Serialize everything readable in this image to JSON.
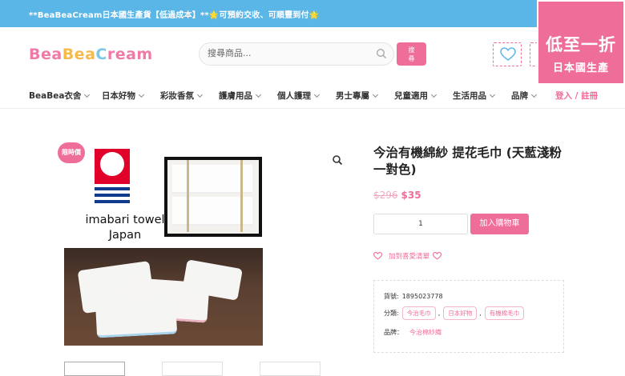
{
  "topbar": {
    "promo": "**BeaBeaCream日本國生產貨【低過成本】**🌟可預約交收、可順豐到付🌟",
    "social_icons": [
      "facebook-icon",
      "instagram-icon"
    ]
  },
  "header": {
    "logo_parts": [
      "Bea",
      "Bea",
      "C",
      "ream",
      ""
    ],
    "search_placeholder": "搜尋商品...",
    "search_button": "搜\n尋"
  },
  "badge": {
    "line1": "低至一折",
    "line2": "日本國生產"
  },
  "nav": {
    "items": [
      {
        "label": "BeaBea衣舍"
      },
      {
        "label": "日本好物"
      },
      {
        "label": "彩妝香氛"
      },
      {
        "label": "護膚用品"
      },
      {
        "label": "個人護理"
      },
      {
        "label": "男士專屬"
      },
      {
        "label": "兒童適用"
      },
      {
        "label": "生活用品"
      },
      {
        "label": "品牌"
      }
    ],
    "login": "登入 / 註冊"
  },
  "gallery": {
    "sale_tag": "限時價",
    "brand_line1": "imabari towel",
    "brand_line2": "Japan"
  },
  "product": {
    "title": "今治有機綿紗 提花毛巾 (天藍淺粉一對色)",
    "old_price": "$296",
    "new_price": "$35",
    "quantity": "1",
    "add_to_cart": "加入購物車",
    "wishlist": "加到喜愛清單",
    "sku_label": "貨號:",
    "sku": "1895023778",
    "category_label": "分類:",
    "categories": [
      "今治毛巾",
      "日本好物",
      "有機棉毛巾"
    ],
    "brand_label": "品牌：",
    "brand": "今治棉紗織"
  },
  "colors": {
    "accent": "#ef6d99",
    "topbar": "#5bb6e8"
  }
}
